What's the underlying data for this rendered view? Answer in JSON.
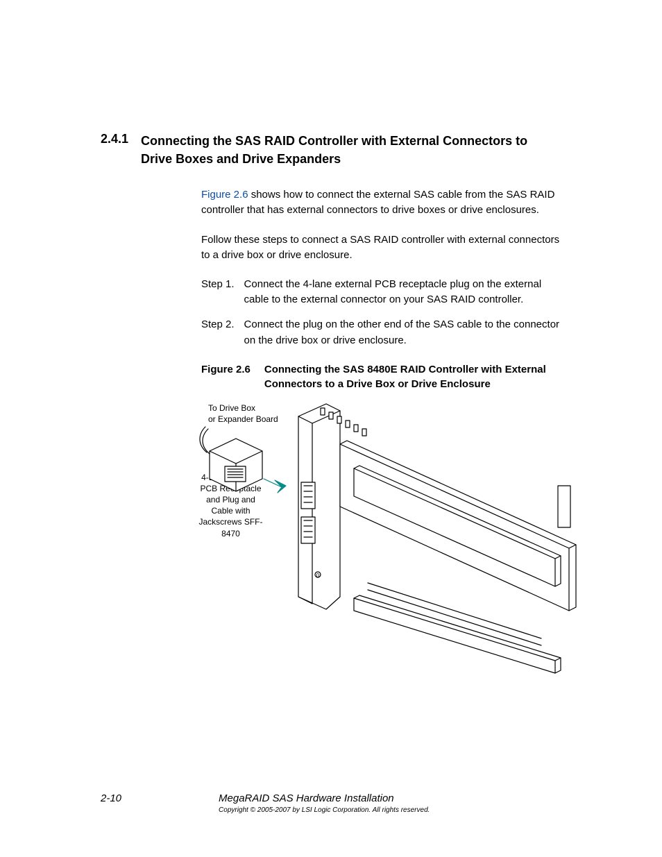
{
  "heading": {
    "number": "2.4.1",
    "title": "Connecting the SAS RAID Controller with External Connectors to Drive Boxes and Drive Expanders"
  },
  "intro": {
    "figure_ref": "Figure 2.6",
    "rest": " shows how to connect the external SAS cable from the SAS RAID controller that has external connectors to drive boxes or drive enclosures."
  },
  "follow": "Follow these steps to connect a SAS RAID controller with external connectors to a drive box or drive enclosure.",
  "steps": [
    {
      "label": "Step 1.",
      "text": "Connect the 4-lane external PCB receptacle plug on the external cable to the external connector on your SAS RAID controller."
    },
    {
      "label": "Step 2.",
      "text": "Connect the plug on the other end of the SAS cable to the connector on the drive box or drive enclosure."
    }
  ],
  "figure": {
    "label": "Figure 2.6",
    "title": "Connecting the SAS 8480E RAID Controller with External Connectors to a Drive Box or Drive Enclosure"
  },
  "annotations": {
    "top": "To Drive Box\nor Expander Board",
    "left": "4-Lane External PCB Receptacle and Plug and Cable with Jackscrews SFF-8470"
  },
  "footer": {
    "page": "2-10",
    "title": "MegaRAID SAS Hardware Installation",
    "copyright": "Copyright © 2005-2007 by LSI Logic Corporation. All rights reserved."
  },
  "chart_data": {
    "type": "diagram",
    "description": "Isometric line drawing of a SAS 8480E RAID controller card on a mounting bracket, with an external SAS cable/plug (SFF-8470) being inserted into the external port. An arrow indicates the insertion direction. Callouts label the cable end 'To Drive Box or Expander Board' and the connector assembly '4-Lane External PCB Receptacle and Plug and Cable with Jackscrews SFF-8470'."
  }
}
